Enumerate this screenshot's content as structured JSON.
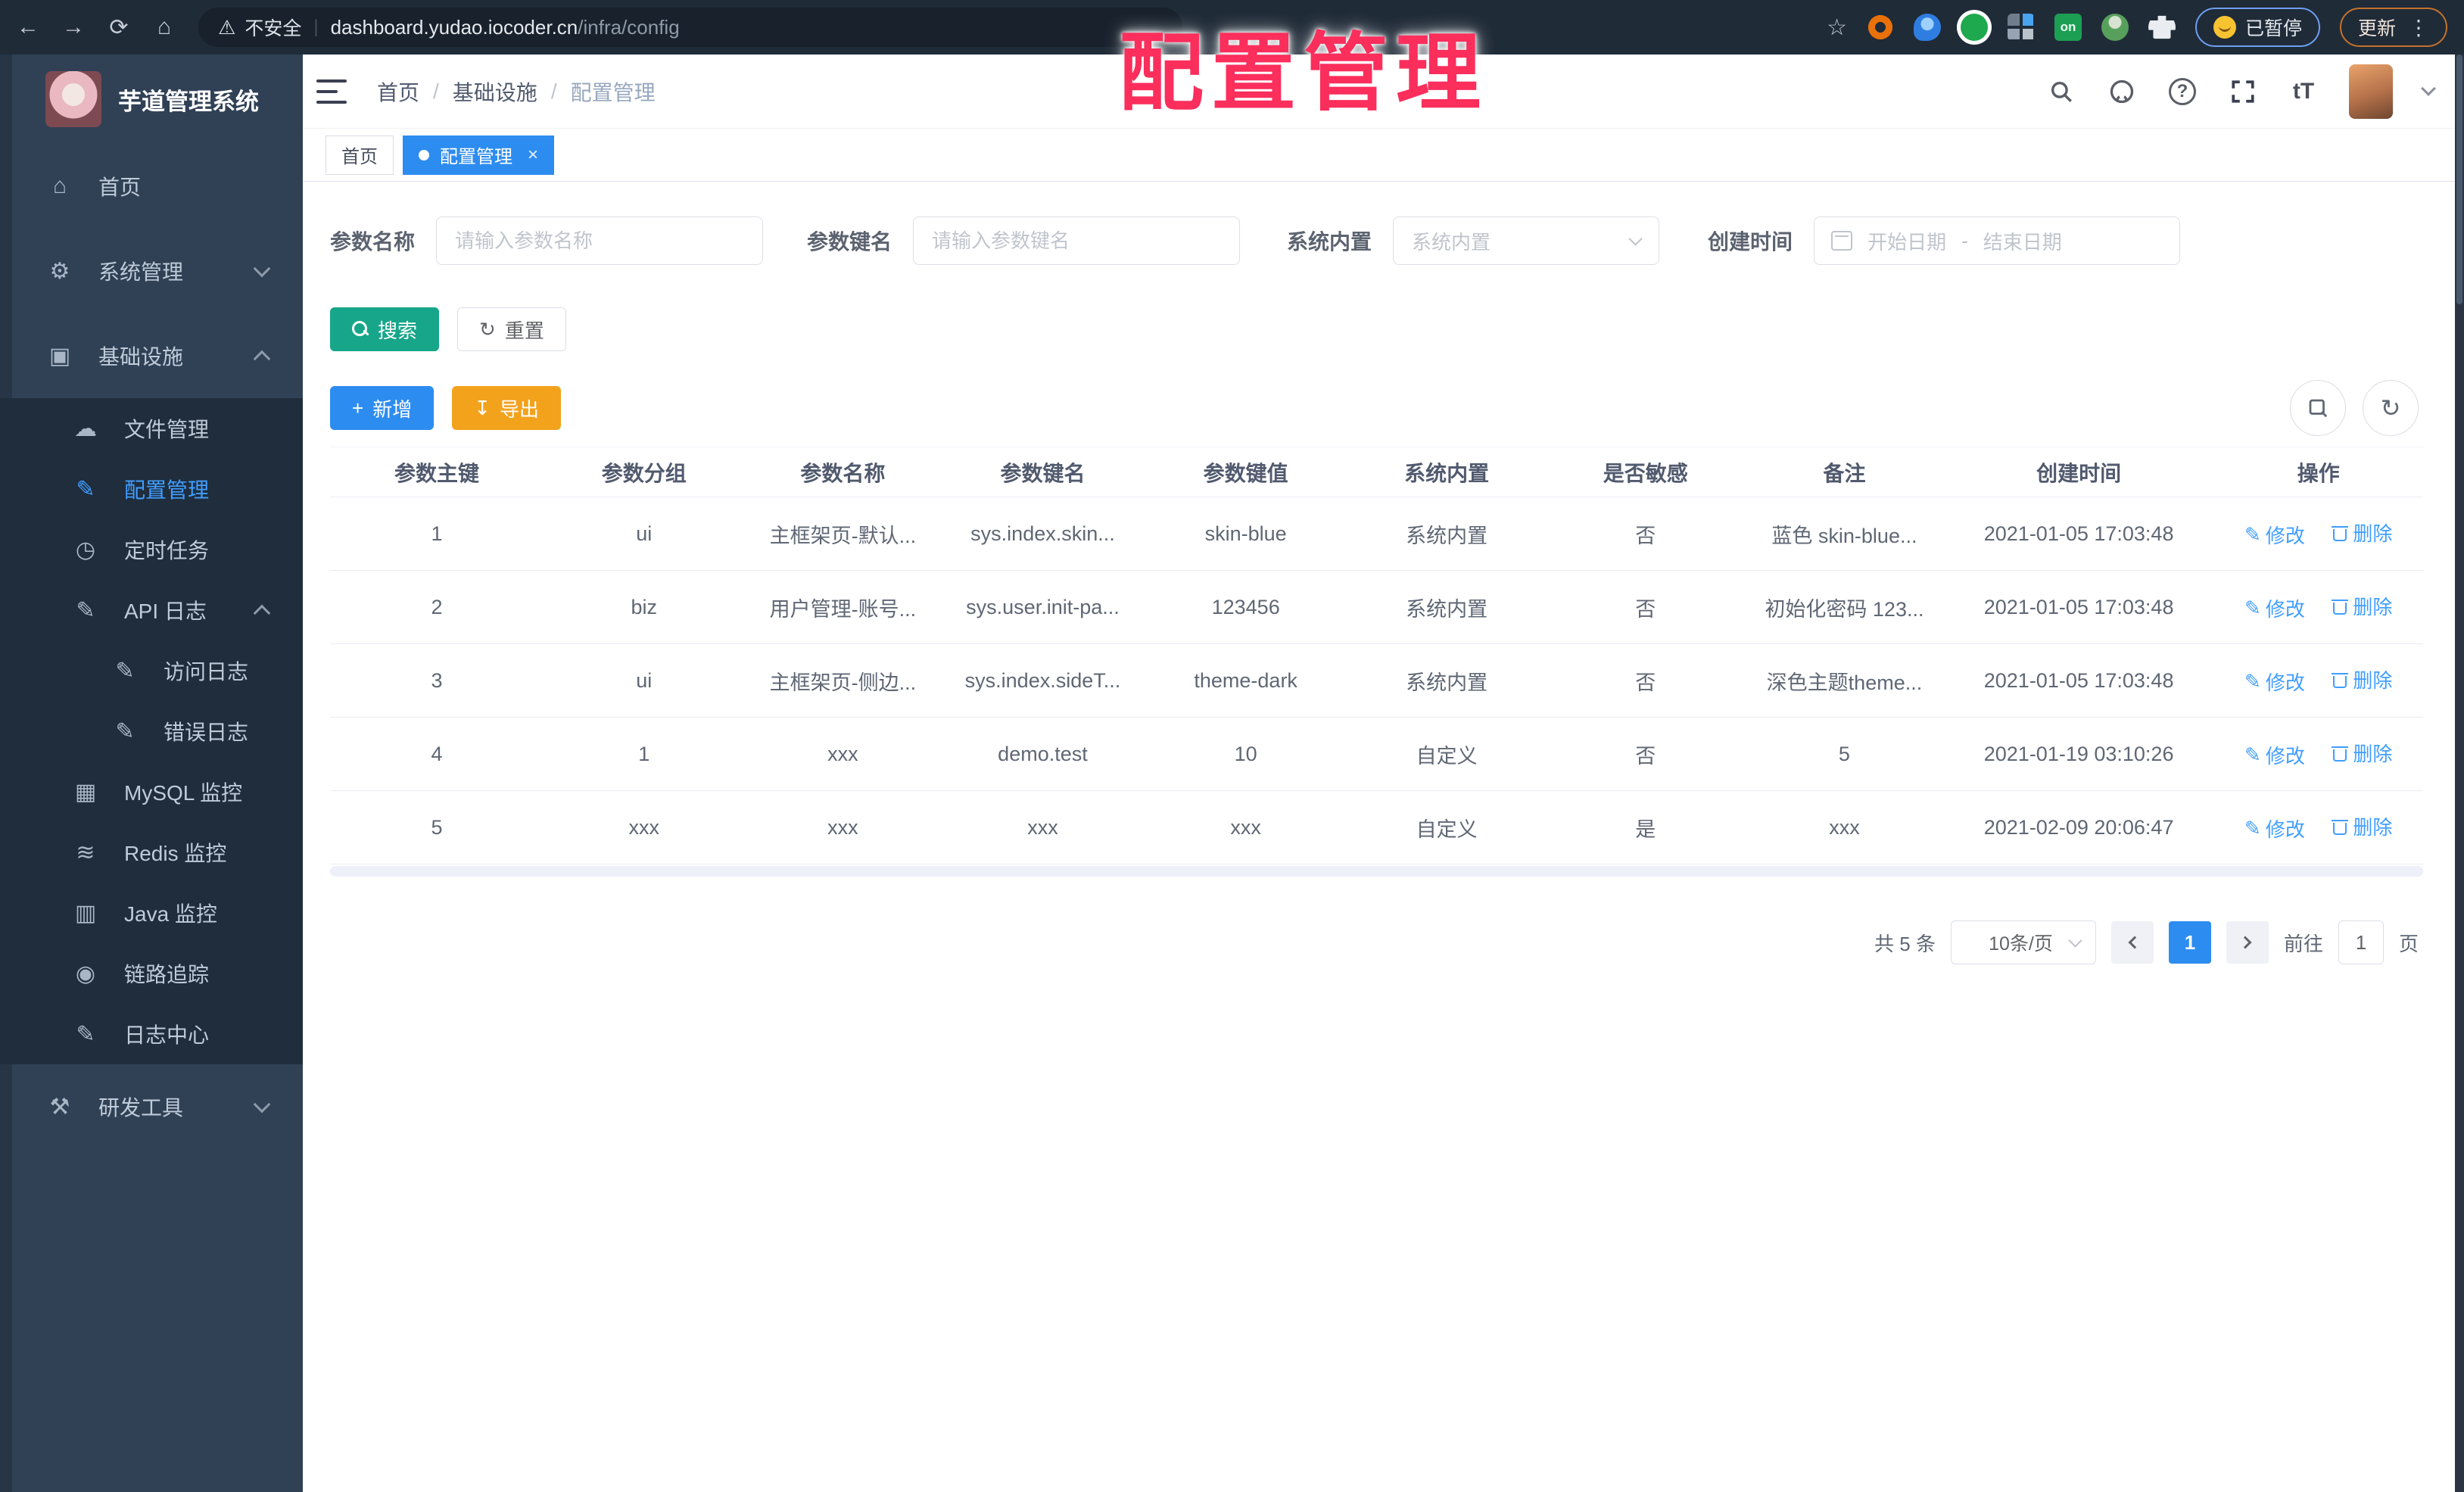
{
  "overlay": {
    "annotation": "配置管理",
    "color": "#fb2e5c"
  },
  "browser": {
    "security_label": "不安全",
    "url_host": "dashboard.yudao.iocoder.cn",
    "url_path": "/infra/config",
    "paused_badge": "已暂停",
    "update_button": "更新"
  },
  "icons": {
    "back": "←",
    "forward": "→",
    "reload": "⟳",
    "home": "⌂",
    "warning": "⚠",
    "star": "☆",
    "kebab": "⋮",
    "menu_home": "⌂",
    "menu_system": "⚙",
    "menu_infra": "▣",
    "menu_file": "☁",
    "menu_config": "✎",
    "menu_job": "◷",
    "menu_api_log": "✎",
    "menu_access_log": "✎",
    "menu_error_log": "✎",
    "menu_mysql": "▦",
    "menu_redis": "≋",
    "menu_java": "▥",
    "menu_trace": "◉",
    "menu_log_center": "✎",
    "menu_tools": "⚒",
    "font_size": "tT",
    "refresh": "↻",
    "plus": "+",
    "download": "↧",
    "edit": "✎",
    "question": "?"
  },
  "sidebar": {
    "title": "芋道管理系统",
    "items": [
      {
        "label": "首页"
      },
      {
        "label": "系统管理"
      },
      {
        "label": "基础设施"
      },
      {
        "label": "文件管理"
      },
      {
        "label": "配置管理"
      },
      {
        "label": "定时任务"
      },
      {
        "label": "API 日志"
      },
      {
        "label": "访问日志"
      },
      {
        "label": "错误日志"
      },
      {
        "label": "MySQL 监控"
      },
      {
        "label": "Redis 监控"
      },
      {
        "label": "Java 监控"
      },
      {
        "label": "链路追踪"
      },
      {
        "label": "日志中心"
      },
      {
        "label": "研发工具"
      }
    ]
  },
  "header": {
    "breadcrumb": [
      "首页",
      "基础设施",
      "配置管理"
    ]
  },
  "tabs": [
    {
      "label": "首页"
    },
    {
      "label": "配置管理"
    }
  ],
  "filters": {
    "name_label": "参数名称",
    "name_placeholder": "请输入参数名称",
    "key_label": "参数键名",
    "key_placeholder": "请输入参数键名",
    "type_label": "系统内置",
    "type_placeholder": "系统内置",
    "date_label": "创建时间",
    "date_start": "开始日期",
    "date_sep": "-",
    "date_end": "结束日期"
  },
  "actions": {
    "search": "搜索",
    "reset": "重置",
    "create": "新增",
    "export": "导出"
  },
  "table": {
    "columns": [
      "参数主键",
      "参数分组",
      "参数名称",
      "参数键名",
      "参数键值",
      "系统内置",
      "是否敏感",
      "备注",
      "创建时间",
      "操作"
    ],
    "edit_label": "修改",
    "delete_label": "删除",
    "rows": [
      {
        "id": "1",
        "group": "ui",
        "name": "主框架页-默认...",
        "key": "sys.index.skin...",
        "value": "skin-blue",
        "type": "系统内置",
        "sensitive": "否",
        "remark": "蓝色 skin-blue...",
        "created": "2021-01-05 17:03:48"
      },
      {
        "id": "2",
        "group": "biz",
        "name": "用户管理-账号...",
        "key": "sys.user.init-pa...",
        "value": "123456",
        "type": "系统内置",
        "sensitive": "否",
        "remark": "初始化密码 123...",
        "created": "2021-01-05 17:03:48"
      },
      {
        "id": "3",
        "group": "ui",
        "name": "主框架页-侧边...",
        "key": "sys.index.sideT...",
        "value": "theme-dark",
        "type": "系统内置",
        "sensitive": "否",
        "remark": "深色主题theme...",
        "created": "2021-01-05 17:03:48"
      },
      {
        "id": "4",
        "group": "1",
        "name": "xxx",
        "key": "demo.test",
        "value": "10",
        "type": "自定义",
        "sensitive": "否",
        "remark": "5",
        "created": "2021-01-19 03:10:26"
      },
      {
        "id": "5",
        "group": "xxx",
        "name": "xxx",
        "key": "xxx",
        "value": "xxx",
        "type": "自定义",
        "sensitive": "是",
        "remark": "xxx",
        "created": "2021-02-09 20:06:47"
      }
    ]
  },
  "pagination": {
    "total": "共 5 条",
    "page_size": "10条/页",
    "current": "1",
    "goto_label": "前往",
    "goto_value": "1",
    "page_label": "页"
  },
  "colors": {
    "accent_blue": "#2d8cf0",
    "link_blue": "#409eff",
    "search_teal": "#17a689",
    "export_orange": "#f3a21c",
    "overlay_red": "#fb2e5c",
    "sidebar_bg": "#304156",
    "submenu_bg": "#1f2d3d",
    "chrome_bg": "#202b38"
  }
}
